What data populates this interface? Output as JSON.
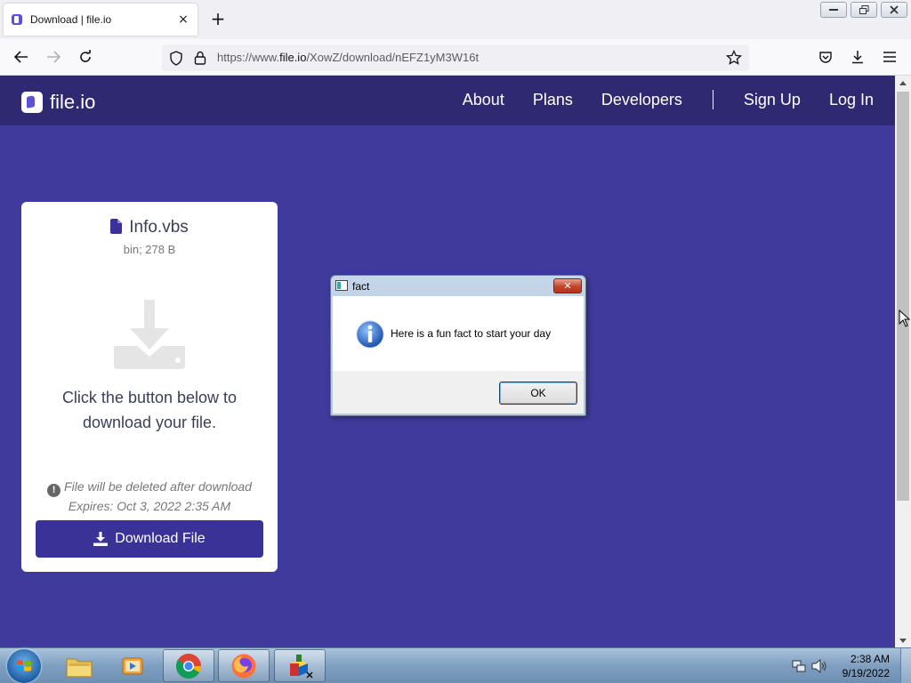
{
  "browser": {
    "tab_title": "Download | file.io",
    "tab_close": "×",
    "new_tab": "+",
    "url_prefix": "https://www.",
    "url_domain": "file.io",
    "url_path": "/XowZ/download/nEFZ1yM3W16t"
  },
  "site": {
    "logo_text": "file.io",
    "nav": {
      "about": "About",
      "plans": "Plans",
      "developers": "Developers",
      "sign_up": "Sign Up",
      "log_in": "Log In"
    }
  },
  "file_card": {
    "file_name": "Info.vbs",
    "file_meta": "bin; 278 B",
    "prompt": "Click the button below to download your file.",
    "delete_note": "File will be deleted after download",
    "expires": "Expires: Oct 3, 2022 2:35 AM",
    "download_label": "Download File"
  },
  "dialog": {
    "title": "fact",
    "message": "Here is a fun fact to start your day",
    "ok_label": "OK",
    "close_glyph": "✕"
  },
  "taskbar": {
    "time": "2:38 AM",
    "date": "9/19/2022"
  },
  "colors": {
    "page_bg": "#3f3a9c",
    "header_bg": "#2e2970",
    "button_bg": "#3a3296"
  }
}
